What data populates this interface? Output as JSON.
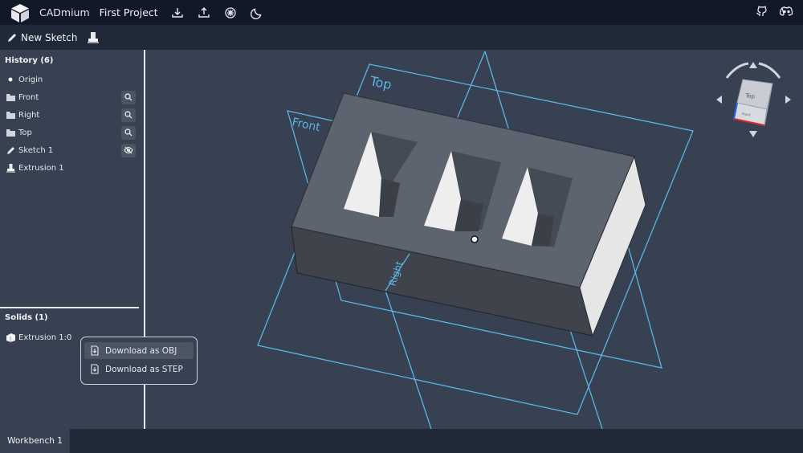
{
  "app": {
    "name": "CADmium",
    "project_name": "First Project"
  },
  "toolbar": {
    "new_sketch_label": "New Sketch"
  },
  "history": {
    "title": "History (6)",
    "items": [
      {
        "label": "Origin",
        "icon": "origin-dot-icon"
      },
      {
        "label": "Front",
        "icon": "plane-icon",
        "action": "search-icon"
      },
      {
        "label": "Right",
        "icon": "plane-icon",
        "action": "search-icon"
      },
      {
        "label": "Top",
        "icon": "plane-icon",
        "action": "search-icon"
      },
      {
        "label": "Sketch 1",
        "icon": "pencil-icon",
        "action": "eye-slash-icon"
      },
      {
        "label": "Extrusion 1",
        "icon": "extrude-icon"
      }
    ]
  },
  "solids": {
    "title": "Solids (1)",
    "items": [
      {
        "label": "Extrusion 1:0",
        "icon": "solid-icon"
      }
    ]
  },
  "context_menu": {
    "items": [
      {
        "label": "Download as OBJ"
      },
      {
        "label": "Download as STEP"
      }
    ]
  },
  "viewport": {
    "plane_labels": {
      "top": "Top",
      "front": "Front",
      "right": "Right"
    },
    "view_cube": {
      "top": "Top",
      "front": "Front",
      "right": "Right"
    }
  },
  "workbench": {
    "tab_label": "Workbench 1"
  },
  "colors": {
    "plane_outline": "#5bb4e5",
    "body_top": "#5d6470",
    "body_side": "#3e434c",
    "pocket_light": "#e6e6e6"
  }
}
